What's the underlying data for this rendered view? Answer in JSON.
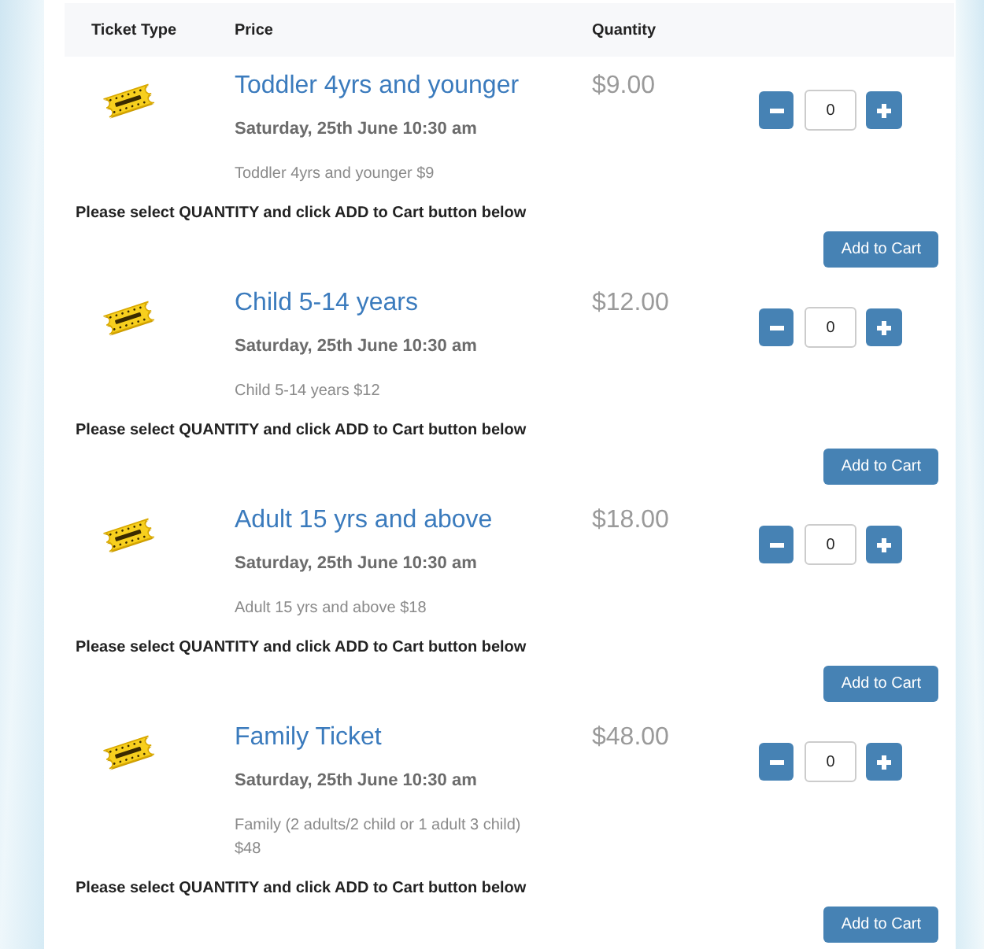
{
  "table": {
    "columns": [
      "Ticket Type",
      "Price",
      "Quantity"
    ],
    "rows": [
      {
        "name": "Toddler 4yrs and younger",
        "date": "Saturday, 25th June 10:30 am",
        "description": "Toddler 4yrs and younger $9",
        "price": "$9.00",
        "quantity": "0",
        "instruction": "Please select QUANTITY and click ADD to Cart button below",
        "button": "Add to Cart"
      },
      {
        "name": "Child 5-14 years",
        "date": "Saturday, 25th June 10:30 am",
        "description": "Child 5-14 years $12",
        "price": "$12.00",
        "quantity": "0",
        "instruction": "Please select QUANTITY and click ADD to Cart button below",
        "button": "Add to Cart"
      },
      {
        "name": "Adult 15 yrs and above",
        "date": "Saturday, 25th June 10:30 am",
        "description": "Adult 15 yrs and above $18",
        "price": "$18.00",
        "quantity": "0",
        "instruction": "Please select QUANTITY and click ADD to Cart button below",
        "button": "Add to Cart"
      },
      {
        "name": "Family Ticket",
        "date": "Saturday, 25th June 10:30 am",
        "description": "Family (2 adults/2 child or 1 adult 3 child) $48",
        "price": "$48.00",
        "quantity": "0",
        "instruction": "Please select QUANTITY and click ADD to Cart button below",
        "button": "Add to Cart"
      }
    ]
  }
}
